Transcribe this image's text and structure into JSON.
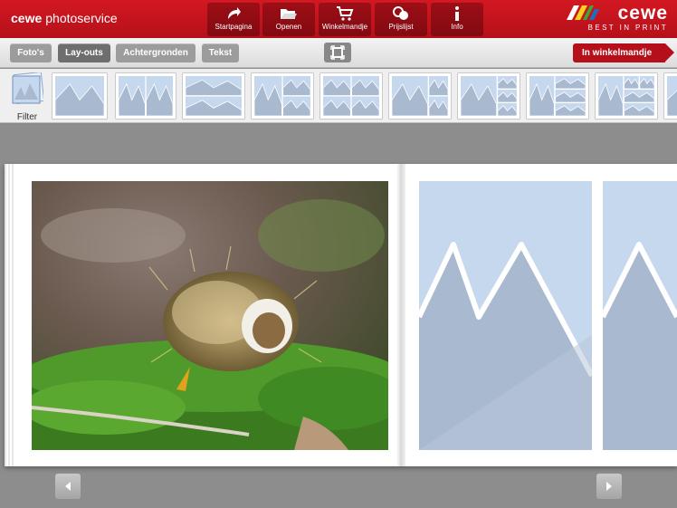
{
  "app": {
    "brand_bold": "cewe",
    "brand_rest": "photoservice"
  },
  "topnav": [
    {
      "label": "Startpagina",
      "icon": "home-arrow-icon"
    },
    {
      "label": "Openen",
      "icon": "open-folder-icon"
    },
    {
      "label": "Winkelmandje",
      "icon": "cart-icon"
    },
    {
      "label": "Prijslijst",
      "icon": "price-coins-icon"
    },
    {
      "label": "Info",
      "icon": "info-icon"
    }
  ],
  "logo": {
    "word": "cewe",
    "tagline": "BEST IN PRINT"
  },
  "toolbar": {
    "tabs": [
      {
        "label": "Foto's",
        "active": false
      },
      {
        "label": "Lay-outs",
        "active": true
      },
      {
        "label": "Achtergronden",
        "active": false
      },
      {
        "label": "Tekst",
        "active": false
      }
    ],
    "fullscreen_icon": "fullscreen-icon",
    "cart_button": "In winkelmandje"
  },
  "strip": {
    "filter_label": "Filter"
  },
  "colors": {
    "brand_red": "#c4121c",
    "placeholder_blue": "#c6d8ee",
    "mountain": "#a9b9cf"
  }
}
